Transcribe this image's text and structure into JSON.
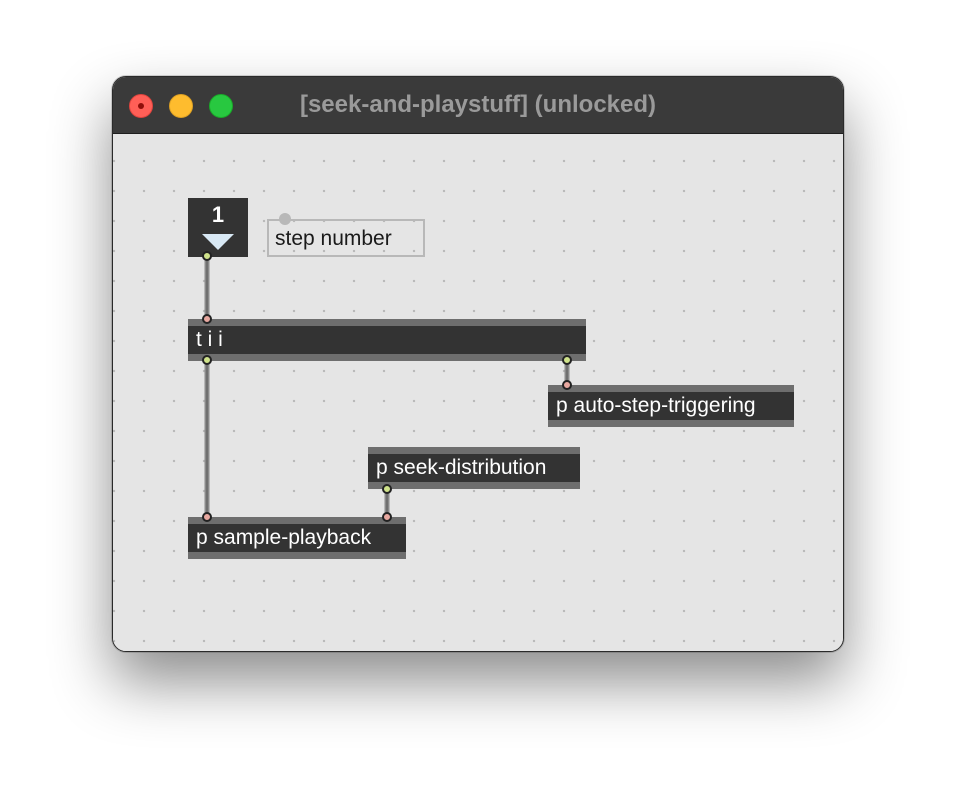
{
  "window": {
    "title": "[seek-and-playstuff] (unlocked)",
    "traffic_lights": {
      "close": "#ff5f57",
      "minimize": "#febc2e",
      "maximize": "#28c840"
    }
  },
  "patch": {
    "number_box": {
      "value": "1"
    },
    "comment": {
      "text": "step number"
    },
    "objects": {
      "trigger": "t i i",
      "auto_step": "p auto-step-triggering",
      "seek_distribution": "p seek-distribution",
      "sample_playback": "p sample-playback"
    }
  },
  "colors": {
    "object_bg": "#333333",
    "object_border": "#6e6e6e",
    "canvas_bg": "#e5e5e5",
    "titlebar_bg": "#3a3a3a"
  }
}
